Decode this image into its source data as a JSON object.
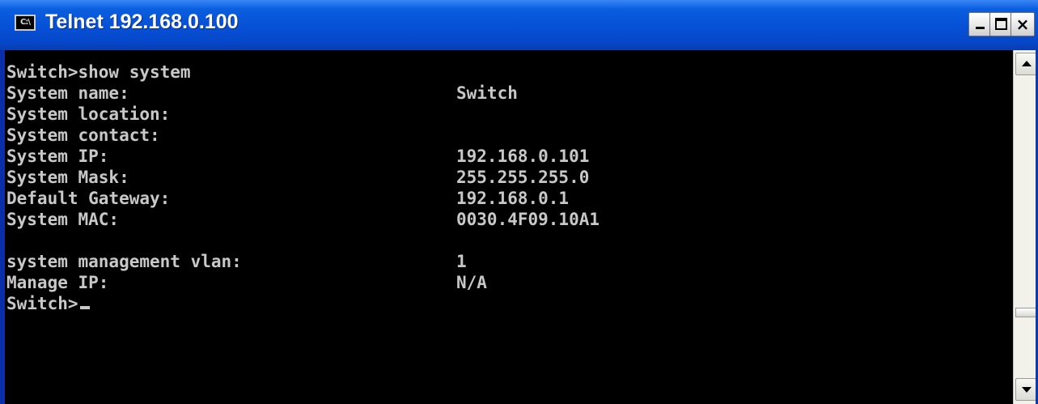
{
  "window": {
    "title": "Telnet 192.168.0.100",
    "icon_label": "C:\\",
    "icon_name": "console-app-icon",
    "controls": {
      "minimize": "minimize-icon",
      "maximize": "maximize-icon",
      "close": "close-icon"
    },
    "close_glyph": "×"
  },
  "console": {
    "command_line": "Switch>show system",
    "fields": [
      {
        "key": "System name:",
        "value": "Switch"
      },
      {
        "key": "System location:",
        "value": ""
      },
      {
        "key": "System contact:",
        "value": ""
      },
      {
        "key": "System IP:",
        "value": "192.168.0.101"
      },
      {
        "key": "System Mask:",
        "value": "255.255.255.0"
      },
      {
        "key": "Default Gateway:",
        "value": "192.168.0.1"
      },
      {
        "key": "System MAC:",
        "value": "0030.4F09.10A1"
      }
    ],
    "fields2": [
      {
        "key": "system management vlan:",
        "value": "1"
      },
      {
        "key": "Manage IP:",
        "value": "N/A"
      }
    ],
    "prompt": "Switch>"
  },
  "colors": {
    "titlebar": "#0650d6",
    "console_bg": "#000000",
    "console_fg": "#c8c8c8"
  }
}
